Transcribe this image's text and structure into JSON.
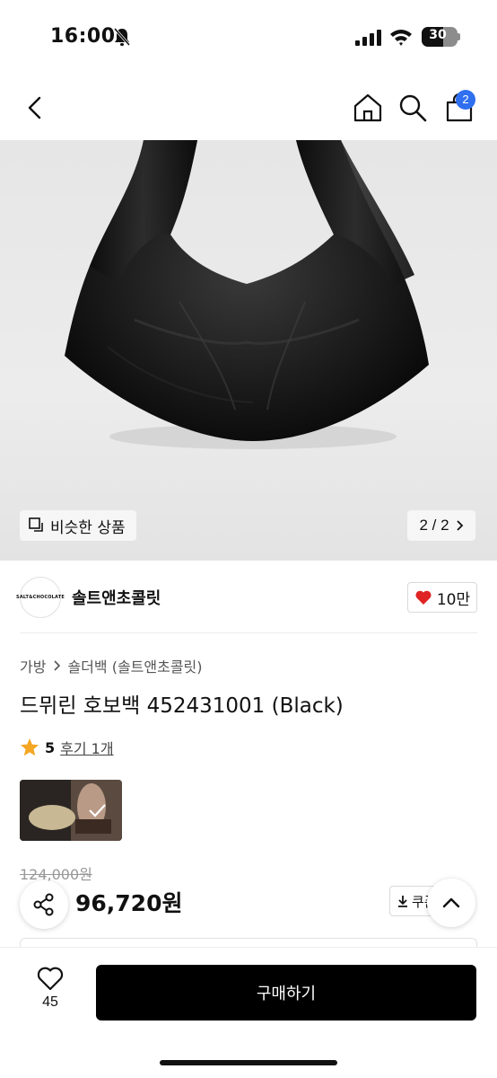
{
  "status_bar": {
    "time": "16:00",
    "battery": "30"
  },
  "header": {
    "cart_count": "2"
  },
  "gallery": {
    "similar_label": "비슷한 상품",
    "page_indicator": "2 / 2"
  },
  "brand": {
    "name": "솔트앤초콜릿",
    "logo_text": "SALT&CHOCOLATE",
    "likes": "10만"
  },
  "product": {
    "breadcrumb": [
      "가방",
      "숄더백 (솔트앤초콜릿)"
    ],
    "title": "드뮈린 호보백 452431001 (Black)",
    "rating": "5",
    "review_link": "후기 1개",
    "original_price": "124,000원",
    "sale_price": "96,720원",
    "coupon_label": "쿠폰"
  },
  "bottom_bar": {
    "wish_count": "45",
    "buy_label": "구매하기"
  },
  "colors": {
    "accent": "#2f6ff0",
    "heart": "#e02424",
    "star": "#f5a623",
    "buy_button": "#000000"
  }
}
